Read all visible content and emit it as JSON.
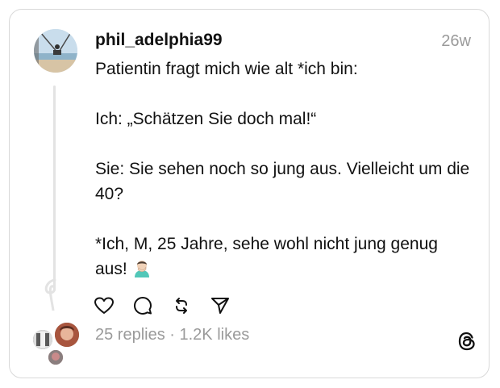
{
  "post": {
    "username": "phil_adelphia99",
    "timestamp": "26w",
    "paragraphs": [
      "Patientin fragt mich wie alt *ich bin:",
      "Ich: „Schätzen Sie doch mal!“",
      "Sie: Sie sehen noch so jung aus. Vielleicht um die 40?",
      "*Ich, M, 25 Jahre, sehe wohl nicht jung genug aus!"
    ],
    "emoji_name": "man-facepalming-emoji",
    "stats_text": "25 replies · 1.2K likes"
  },
  "icons": {
    "like": "heart-icon",
    "reply": "comment-icon",
    "repost": "repost-icon",
    "share": "send-icon",
    "brand": "threads-logo-icon"
  },
  "colors": {
    "text": "#111111",
    "muted": "#9a9a9a",
    "border": "#d9d9d9",
    "thread_line": "#e3e3e3"
  }
}
